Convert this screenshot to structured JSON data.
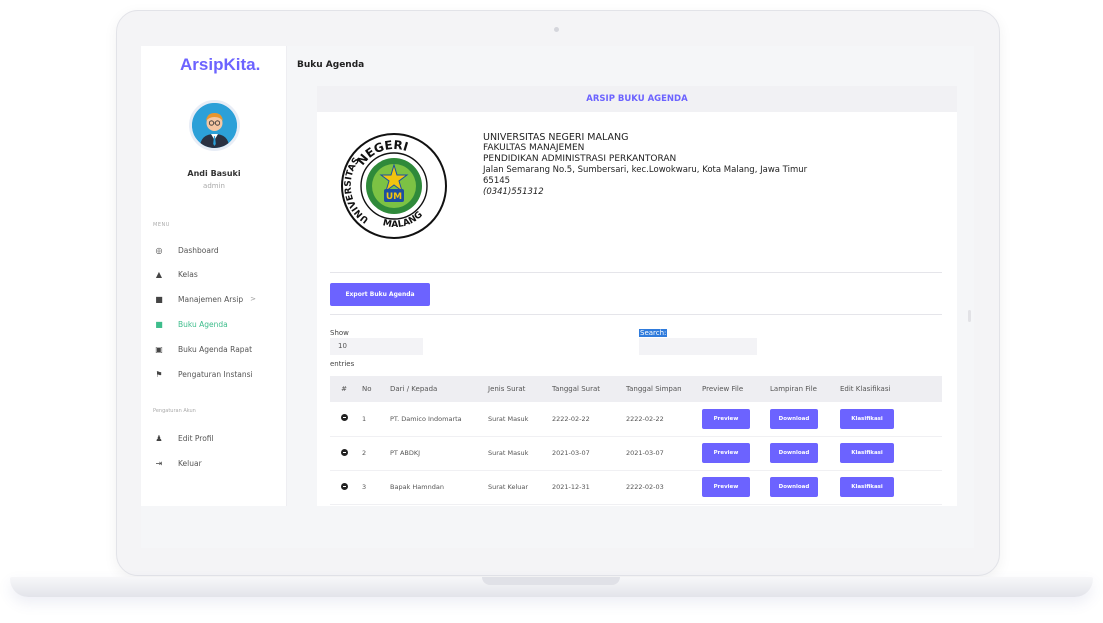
{
  "sidebar": {
    "brand": "ArsipKita.",
    "user_name": "Andi Basuki",
    "user_role": "admin",
    "menu_heading": "MENU",
    "settings_heading": "Pengaturan Akun",
    "items": [
      {
        "label": "Dashboard",
        "icon": "dashboard-icon"
      },
      {
        "label": "Kelas",
        "icon": "graduation-cap-icon"
      },
      {
        "label": "Manajemen Arsip",
        "icon": "file-icon",
        "chevron": ">"
      },
      {
        "label": "Buku Agenda",
        "icon": "book-icon",
        "active": true
      },
      {
        "label": "Buku Agenda Rapat",
        "icon": "calendar-icon"
      },
      {
        "label": "Pengaturan Instansi",
        "icon": "flag-icon"
      }
    ],
    "account_items": [
      {
        "label": "Edit Profil",
        "icon": "user-edit-icon"
      },
      {
        "label": "Keluar",
        "icon": "sign-out-icon"
      }
    ]
  },
  "page": {
    "title": "Buku Agenda"
  },
  "card": {
    "header": "ARSIP BUKU AGENDA",
    "logo_text_top": "NEGERI",
    "logo_text_left": "UNIVERSITAS",
    "logo_text_bottom": "MALANG",
    "logo_emblem": "UM",
    "institution": {
      "line1": "UNIVERSITAS NEGERI MALANG",
      "line2": "FAKULTAS MANAJEMEN",
      "line3": "PENDIDIKAN ADMINISTRASI PERKANTORAN",
      "line4": "Jalan Semarang No.5, Sumbersari, kec.Lowokwaru, Kota Malang, Jawa Timur",
      "line5": "65145",
      "phone": "(0341)551312"
    },
    "export_label": "Export Buku Agenda",
    "show_label": "Show",
    "show_value": "10",
    "entries_label": "entries",
    "search_label": "Search:"
  },
  "table": {
    "headers": [
      "#",
      "No",
      "Dari / Kepada",
      "Jenis Surat",
      "Tanggal Surat",
      "Tanggal Simpan",
      "Preview File",
      "Lampiran File",
      "Edit Klasifikasi"
    ],
    "rows": [
      {
        "no": "1",
        "dari": "PT. Damico Indomarta",
        "jenis": "Surat Masuk",
        "tgl_surat": "2222-02-22",
        "tgl_simpan": "2222-02-22"
      },
      {
        "no": "2",
        "dari": "PT ABDKJ",
        "jenis": "Surat Masuk",
        "tgl_surat": "2021-03-07",
        "tgl_simpan": "2021-03-07"
      },
      {
        "no": "3",
        "dari": "Bapak Hamndan",
        "jenis": "Surat Keluar",
        "tgl_surat": "2021-12-31",
        "tgl_simpan": "2222-02-03"
      }
    ],
    "preview_label": "Preview",
    "download_label": "Download",
    "klasifikasi_label": "Klasifikasi"
  },
  "colors": {
    "accent": "#6c63ff",
    "active": "#3ebd8c"
  }
}
